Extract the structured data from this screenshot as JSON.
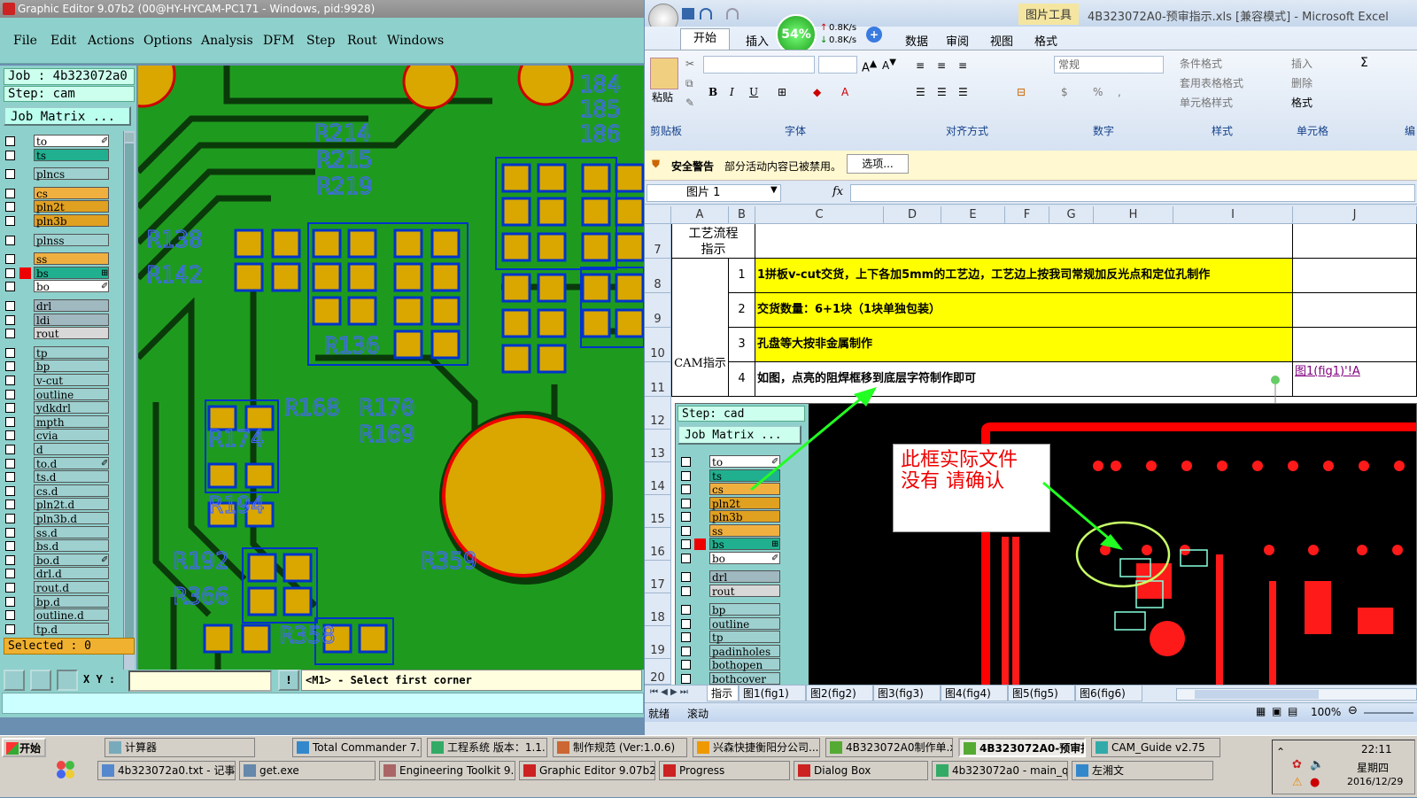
{
  "ge": {
    "title": "Graphic Editor 9.07b2 (00@HY-HYCAM-PC171 - Windows, pid:9928)",
    "menu": [
      "File",
      "Edit",
      "Actions",
      "Options",
      "Analysis",
      "DFM",
      "Step",
      "Rout",
      "Windows"
    ],
    "job_label": "Job : 4b323072a0",
    "step_label": "Step: cam",
    "job_matrix": "Job Matrix ...",
    "layers": [
      {
        "name": "to",
        "color": "#ffffff",
        "mark": "✐"
      },
      {
        "name": "ts",
        "color": "#20b090"
      },
      {
        "name": "plncs",
        "color": "#9ed0d0"
      },
      {
        "name": "cs",
        "color": "#f0b040"
      },
      {
        "name": "pln2t",
        "color": "#e0a020"
      },
      {
        "name": "pln3b",
        "color": "#e0a020"
      },
      {
        "name": "plnss",
        "color": "#9ed0d0"
      },
      {
        "name": "ss",
        "color": "#f0b040"
      },
      {
        "name": "bs",
        "color": "#20b090",
        "mark": "⊞"
      },
      {
        "name": "bo",
        "color": "#ffffff",
        "mark": "✐"
      },
      {
        "name": "drl",
        "color": "#a0b8c0"
      },
      {
        "name": "ldi",
        "color": "#a0b8c0"
      },
      {
        "name": "rout",
        "color": "#d8d8d8"
      },
      {
        "name": "tp",
        "color": "#9ed0d0"
      },
      {
        "name": "bp",
        "color": "#9ed0d0"
      },
      {
        "name": "v-cut",
        "color": "#9ed0d0"
      },
      {
        "name": "outline",
        "color": "#9ed0d0"
      },
      {
        "name": "ydkdrl",
        "color": "#9ed0d0"
      },
      {
        "name": "mpth",
        "color": "#9ed0d0"
      },
      {
        "name": "cvia",
        "color": "#9ed0d0"
      },
      {
        "name": "d",
        "color": "#9ed0d0"
      },
      {
        "name": "to.d",
        "color": "#9ed0d0",
        "mark": "✐"
      },
      {
        "name": "ts.d",
        "color": "#9ed0d0"
      },
      {
        "name": "cs.d",
        "color": "#9ed0d0"
      },
      {
        "name": "pln2t.d",
        "color": "#9ed0d0"
      },
      {
        "name": "pln3b.d",
        "color": "#9ed0d0"
      },
      {
        "name": "ss.d",
        "color": "#9ed0d0"
      },
      {
        "name": "bs.d",
        "color": "#9ed0d0"
      },
      {
        "name": "bo.d",
        "color": "#9ed0d0",
        "mark": "✐"
      },
      {
        "name": "drl.d",
        "color": "#9ed0d0"
      },
      {
        "name": "rout.d",
        "color": "#9ed0d0"
      },
      {
        "name": "bp.d",
        "color": "#9ed0d0"
      },
      {
        "name": "outline.d",
        "color": "#9ed0d0"
      },
      {
        "name": "tp.d",
        "color": "#9ed0d0"
      }
    ],
    "selected": "Selected : 0",
    "xy_label": "X Y :",
    "prompt": "<M1> - Select first corner",
    "silk": [
      "R214",
      "R212",
      "R215",
      "R213",
      "R219",
      "R218",
      "R138",
      "R142",
      "R136",
      "R168",
      "R170",
      "R169",
      "R171",
      "R174",
      "R175",
      "R194",
      "R192",
      "R366",
      "R358",
      "R359",
      "R355",
      "R205",
      "R208",
      "184",
      "185",
      "186"
    ]
  },
  "excel": {
    "title": "4B323072A0-预审指示.xls [兼容模式] - Microsoft Excel",
    "context_tab": "图片工具",
    "tabs": [
      "开始",
      "插入",
      "数据",
      "审阅",
      "视图",
      "格式"
    ],
    "net_percent": "54%",
    "net_up": "0.8K/s",
    "net_down": "0.8K/s",
    "groups": [
      "剪贴板",
      "字体",
      "对齐方式",
      "数字",
      "样式",
      "单元格",
      "编"
    ],
    "paste": "粘贴",
    "number_format": "常规",
    "styles": [
      "条件格式",
      "套用表格格式",
      "单元格样式"
    ],
    "cells_btns": [
      "插入",
      "删除",
      "格式"
    ],
    "security_title": "安全警告",
    "security_msg": "部分活动内容已被禁用。",
    "security_btn": "选项...",
    "name_box": "图片 1",
    "fx": "fx",
    "columns": [
      "A",
      "B",
      "C",
      "D",
      "E",
      "F",
      "G",
      "H",
      "I",
      "J"
    ],
    "rows": [
      "7",
      "8",
      "9",
      "10",
      "11",
      "12",
      "13",
      "14",
      "15",
      "16",
      "17",
      "18",
      "19",
      "20"
    ],
    "process_header": "工艺流程指示",
    "cam_label": "CAM指示",
    "items": [
      {
        "n": "1",
        "text": "1拼板v-cut交货，上下各加5mm的工艺边，工艺边上按我司常规加反光点和定位孔制作"
      },
      {
        "n": "2",
        "text": "交货数量：6+1块（1块单独包装）"
      },
      {
        "n": "3",
        "text": "孔盘等大按非金属制作"
      },
      {
        "n": "4",
        "text": "如图，点亮的阻焊框移到底层字符制作即可"
      }
    ],
    "link_text": "图1(fig1)'!A",
    "embedded_step": "Step: cad",
    "embedded_matrix": "Job Matrix ...",
    "embedded_layers": [
      {
        "name": "to",
        "color": "#ffffff",
        "mark": "✐"
      },
      {
        "name": "ts",
        "color": "#20b090"
      },
      {
        "name": "cs",
        "color": "#f0b040"
      },
      {
        "name": "pln2t",
        "color": "#e0a020"
      },
      {
        "name": "pln3b",
        "color": "#e0a020"
      },
      {
        "name": "ss",
        "color": "#f0b040"
      },
      {
        "name": "bs",
        "color": "#20b090",
        "mark": "⊞"
      },
      {
        "name": "bo",
        "color": "#ffffff",
        "mark": "✐"
      },
      {
        "name": "drl",
        "color": "#a0b8c0"
      },
      {
        "name": "rout",
        "color": "#d8d8d8"
      },
      {
        "name": "bp",
        "color": "#9ed0d0"
      },
      {
        "name": "outline",
        "color": "#9ed0d0"
      },
      {
        "name": "tp",
        "color": "#9ed0d0"
      },
      {
        "name": "padinholes",
        "color": "#9ed0d0"
      },
      {
        "name": "bothopen",
        "color": "#9ed0d0"
      },
      {
        "name": "bothcover",
        "color": "#9ed0d0"
      }
    ],
    "note": "此框实际文件没有 请确认",
    "note_line1": "此框实际文件",
    "note_line2": "没有  请确认",
    "sheets": [
      "指示",
      "图1(fig1)",
      "图2(fig2)",
      "图3(fig3)",
      "图4(fig4)",
      "图5(fig5)",
      "图6(fig6)"
    ],
    "status_ready": "就绪",
    "status_scroll": "滚动",
    "zoom": "100%"
  },
  "taskbar": {
    "start": "开始",
    "row1": [
      "计算器",
      "Total Commander 7.0 p...",
      "工程系统  版本：1.1...",
      "制作规范 (Ver:1.0.6)",
      "兴森快捷衡阳分公司...",
      "4B323072A0制作单.xl...",
      "4B323072A0-预审指...",
      "CAM_Guide v2.75"
    ],
    "row2": [
      "4b323072a0.txt - 记事本",
      "get.exe",
      "Engineering Toolkit 9.07...",
      "Graphic Editor 9.07b2 (0...",
      "Progress",
      "Dialog Box",
      "4b323072a0 - main_qa",
      "左湘文"
    ],
    "time": "22:11",
    "weekday": "星期四",
    "date": "2016/12/29"
  }
}
